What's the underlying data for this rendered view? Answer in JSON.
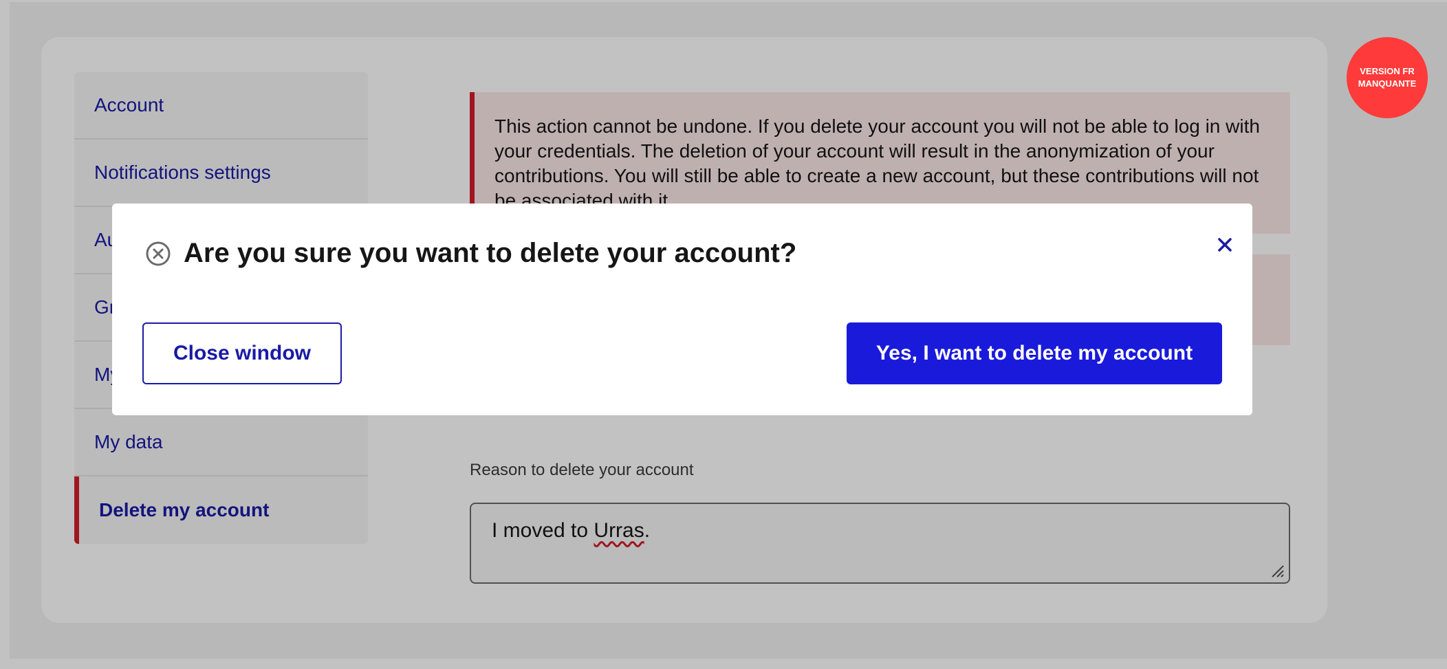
{
  "sidebar": {
    "items": [
      {
        "label": "Account"
      },
      {
        "label": "Notifications settings"
      },
      {
        "label": "Au"
      },
      {
        "label": "Gr"
      },
      {
        "label": "My"
      },
      {
        "label": "My data"
      },
      {
        "label": "Delete my account"
      }
    ]
  },
  "warning": {
    "text": "This action cannot be undone. If you delete your account you will not be able to log in with your credentials. The deletion of your account will result in the anonymization of your contributions. You will still be able to create a new account, but these contributions will not be associated with it."
  },
  "reason": {
    "label": "Reason to delete your account",
    "value_prefix": "I moved to ",
    "value_misspelled": "Urras",
    "value_suffix": "."
  },
  "badge": {
    "line1": "VERSION FR",
    "line2": "MANQUANTE"
  },
  "modal": {
    "title": "Are you sure you want to delete your account?",
    "close_label": "×",
    "secondary_button": "Close window",
    "primary_button": "Yes, I want to delete my account"
  },
  "colors": {
    "accent": "#1a1aa6",
    "primary_button": "#1a1adb",
    "danger": "#d31d2b",
    "badge": "#ff3a3a"
  }
}
